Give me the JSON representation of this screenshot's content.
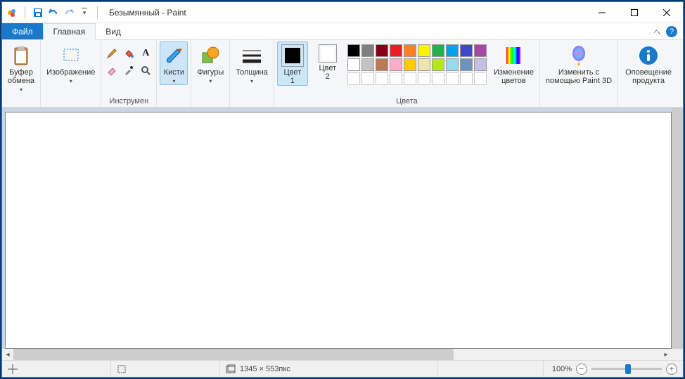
{
  "title": "Безымянный - Paint",
  "tabs": {
    "file": "Файл",
    "home": "Главная",
    "view": "Вид"
  },
  "ribbon": {
    "clipboard": {
      "btn": "Буфер\nобмена",
      "group": ""
    },
    "image": {
      "btn": "Изображение",
      "group": ""
    },
    "tools": {
      "group": "Инструмен"
    },
    "brushes": {
      "btn": "Кисти"
    },
    "shapes": {
      "btn": "Фигуры"
    },
    "thickness": {
      "btn": "Толщина"
    },
    "color1": {
      "lbl": "Цвет\n1"
    },
    "color2": {
      "lbl": "Цвет\n2"
    },
    "editcolors": {
      "lbl": "Изменение\nцветов"
    },
    "colors_group": "Цвета",
    "paint3d": {
      "lbl": "Изменить с\nпомощью Paint 3D"
    },
    "alert": {
      "lbl": "Оповещение\nпродукта"
    }
  },
  "palette_row1": [
    "#000000",
    "#7f7f7f",
    "#880015",
    "#ed1c24",
    "#ff7f27",
    "#fff200",
    "#22b14c",
    "#00a2e8",
    "#3f48cc",
    "#a349a4"
  ],
  "palette_row2": [
    "#ffffff",
    "#c3c3c3",
    "#b97a57",
    "#ffaec9",
    "#ffc90e",
    "#efe4b0",
    "#b5e61d",
    "#99d9ea",
    "#7092be",
    "#c8bfe7"
  ],
  "color1_value": "#000000",
  "color2_value": "#ffffff",
  "status": {
    "dims": "1345 × 553пкс",
    "zoom": "100%"
  }
}
